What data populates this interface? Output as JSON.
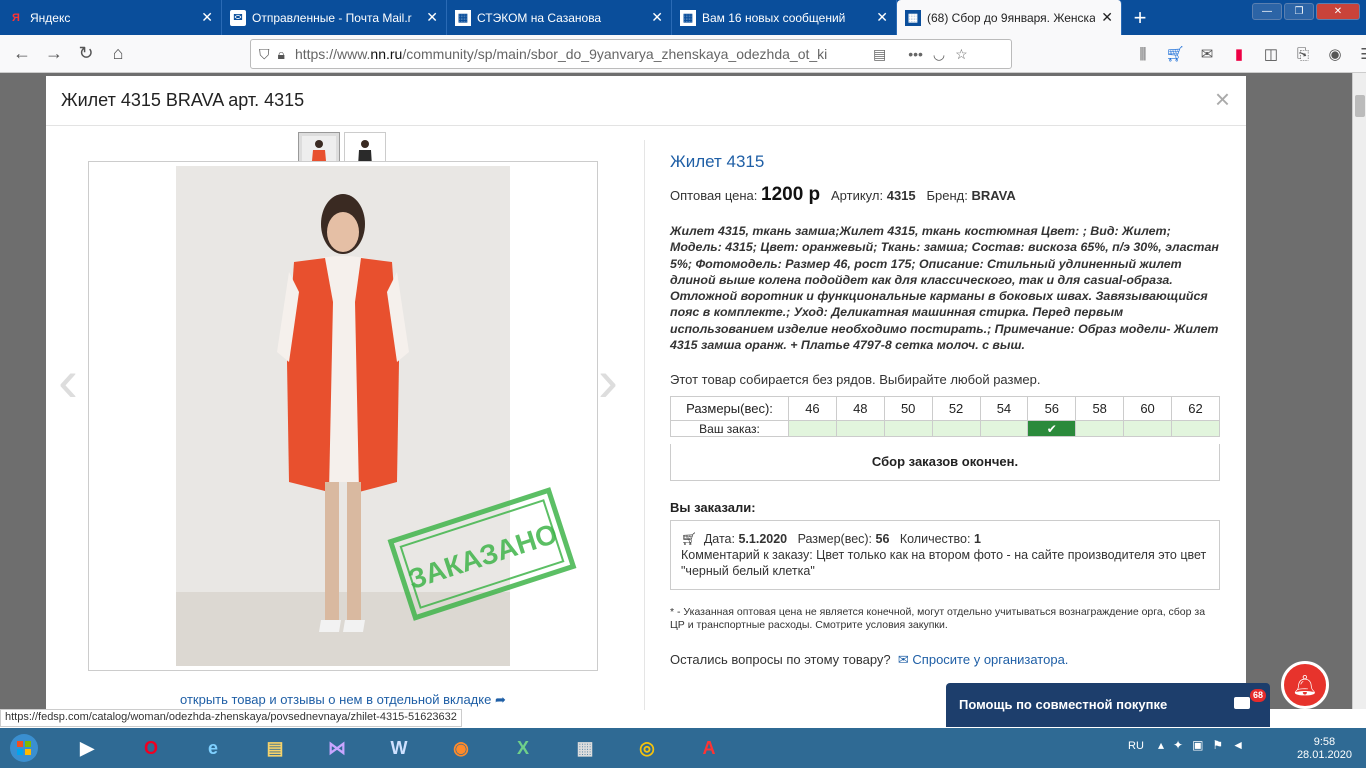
{
  "browser": {
    "tabs": [
      {
        "icon": "yandex-icon",
        "title": "Яндекс",
        "active": false
      },
      {
        "icon": "mail-icon",
        "title": "Отправленные - Почта Mail.r",
        "active": false
      },
      {
        "icon": "tile-icon",
        "title": "СТЭКОМ на Сазанова",
        "active": false
      },
      {
        "icon": "tile-icon",
        "title": "Вам 16 новых сообщений",
        "active": false
      },
      {
        "icon": "tile-icon",
        "title": "(68) Сбор до 9января. Женска",
        "active": true
      }
    ],
    "url_prefix": "https://www.",
    "url_domain": "nn.ru",
    "url_rest": "/community/sp/main/sbor_do_9yanvarya_zhenskaya_odezhda_ot_ki"
  },
  "modal": {
    "title": "Жилет 4315 BRAVA арт. 4315",
    "close_glyph": "×",
    "stamp_text": "ЗАКАЗАНО",
    "open_link": "открыть товар и отзывы о нем в отдельной вкладке",
    "product": {
      "name": "Жилет 4315",
      "price_label": "Оптовая цена:",
      "price": "1200 р",
      "article_label": "Артикул:",
      "article": "4315",
      "brand_label": "Бренд:",
      "brand": "BRAVA",
      "description": "Жилет 4315, ткань замша;Жилет 4315, ткань костюмная Цвет: ; Вид: Жилет; Модель: 4315; Цвет: оранжевый; Ткань: замша; Состав: вискоза 65%, п/э 30%, эластан 5%; Фотомодель: Размер 46, рост 175; Описание: Стильный удлиненный жилет длиной выше колена подойдет как для классического, так и для casual-образа. Отложной воротник и функциональные карманы в боковых швах. Завязывающийся пояс в комплекте.; Уход: Деликатная машинная стирка. Перед первым использованием изделие необходимо постирать.; Примечание: Образ модели- Жилет 4315 замша оранж. + Платье 4797-8 сетка молоч. с выш.",
      "rows_note": "Этот товар собирается без рядов. Выбирайте любой размер.",
      "sizes_label": "Размеры(вес):",
      "sizes": [
        "46",
        "48",
        "50",
        "52",
        "54",
        "56",
        "58",
        "60",
        "62"
      ],
      "order_label": "Ваш заказ:",
      "ordered_size": "56",
      "collection_closed": "Сбор заказов окончен.",
      "ordered_heading": "Вы заказали:",
      "order": {
        "date_label": "Дата:",
        "date": "5.1.2020",
        "size_label": "Размер(вес):",
        "size": "56",
        "qty_label": "Количество:",
        "qty": "1",
        "comment": "Комментарий к заказу: Цвет только как на втором фото - на сайте производителя это цвет \"черный белый клетка\""
      },
      "footnote": "* - Указанная оптовая цена не является конечной, могут отдельно учитываться вознаграждение орга, сбор за ЦР и транспортные расходы. Смотрите условия закупки.",
      "question": "Остались вопросы по этому товару?",
      "ask_link": "Спросите у организатора."
    }
  },
  "help_widget": {
    "label": "Помощь по совместной покупке",
    "badge": "68"
  },
  "status_url": "https://fedsp.com/catalog/woman/odezhda-zhenskaya/povsednevnaya/zhilet-4315-51623632",
  "taskbar": {
    "lang": "RU",
    "time": "9:58",
    "date": "28.01.2020"
  },
  "colors": {
    "accent": "#1f5fa6",
    "vest": "#e8502e",
    "check": "#2b8a3b"
  }
}
